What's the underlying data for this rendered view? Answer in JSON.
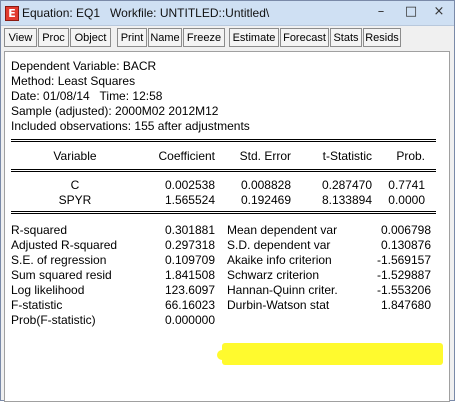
{
  "window": {
    "app_icon": "E",
    "title": "Equation: EQ1   Workfile: UNTITLED::Untitled\\",
    "controls": {
      "minimize": "–",
      "restore": "□",
      "close": "×"
    }
  },
  "toolbar": [
    "View",
    "Proc",
    "Object",
    "Print",
    "Name",
    "Freeze",
    "Estimate",
    "Forecast",
    "Stats",
    "Resids"
  ],
  "header_lines": [
    "Dependent Variable: BACR",
    "Method: Least Squares",
    "Date: 01/08/14   Time: 12:58",
    "Sample (adjusted): 2000M02 2012M12",
    "Included observations: 155 after adjustments"
  ],
  "coef_table": {
    "columns": [
      "Variable",
      "Coefficient",
      "Std. Error",
      "t-Statistic",
      "Prob."
    ],
    "rows": [
      [
        "C",
        "0.002538",
        "0.008828",
        "0.287470",
        "0.7741"
      ],
      [
        "SPYR",
        "1.565524",
        "0.192469",
        "8.133894",
        "0.0000"
      ]
    ]
  },
  "stats": {
    "left": [
      [
        "R-squared",
        "0.301881"
      ],
      [
        "Adjusted R-squared",
        "0.297318"
      ],
      [
        "S.E. of regression",
        "0.109709"
      ],
      [
        "Sum squared resid",
        "1.841508"
      ],
      [
        "Log likelihood",
        "123.6097"
      ],
      [
        "F-statistic",
        "66.16023"
      ],
      [
        "Prob(F-statistic)",
        "0.000000"
      ]
    ],
    "right": [
      [
        "Mean dependent var",
        "0.006798"
      ],
      [
        "S.D. dependent var",
        "0.130876"
      ],
      [
        "Akaike info criterion",
        "-1.569157"
      ],
      [
        "Schwarz criterion",
        "-1.529887"
      ],
      [
        "Hannan-Quinn criter.",
        "-1.553206"
      ],
      [
        "Durbin-Watson stat",
        "1.847680"
      ]
    ]
  },
  "colors": {
    "highlight": "#fffa2e",
    "titlebar": "#cfe0f3",
    "app_icon": "#e23b2f"
  }
}
